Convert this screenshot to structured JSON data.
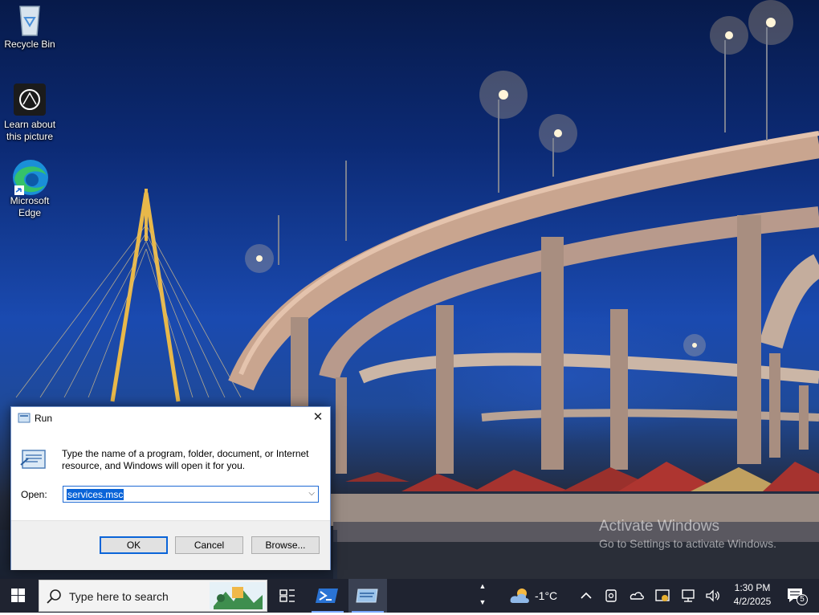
{
  "desktop": {
    "icons": [
      {
        "label": "Recycle Bin",
        "icon": "recycle-bin-icon"
      },
      {
        "label": "Learn about this picture",
        "icon": "camera-lens-icon"
      },
      {
        "label": "Microsoft Edge",
        "icon": "edge-icon"
      }
    ],
    "watermark": {
      "line1": "Activate Windows",
      "line2": "Go to Settings to activate Windows."
    }
  },
  "run_dialog": {
    "title": "Run",
    "description": "Type the name of a program, folder, document, or Internet resource, and Windows will open it for you.",
    "open_label": "Open:",
    "open_value": "services.msc",
    "buttons": {
      "ok": "OK",
      "cancel": "Cancel",
      "browse": "Browse..."
    }
  },
  "taskbar": {
    "search_placeholder": "Type here to search",
    "weather": {
      "temperature": "-1°C",
      "icon": "partly-cloudy-icon"
    },
    "clock": {
      "time": "1:30 PM",
      "date": "4/2/2025"
    },
    "notification_count": "5"
  },
  "colors": {
    "accent": "#0a64d8",
    "taskbar": "#1f2330",
    "dialog_footer": "#f0f0f0"
  }
}
